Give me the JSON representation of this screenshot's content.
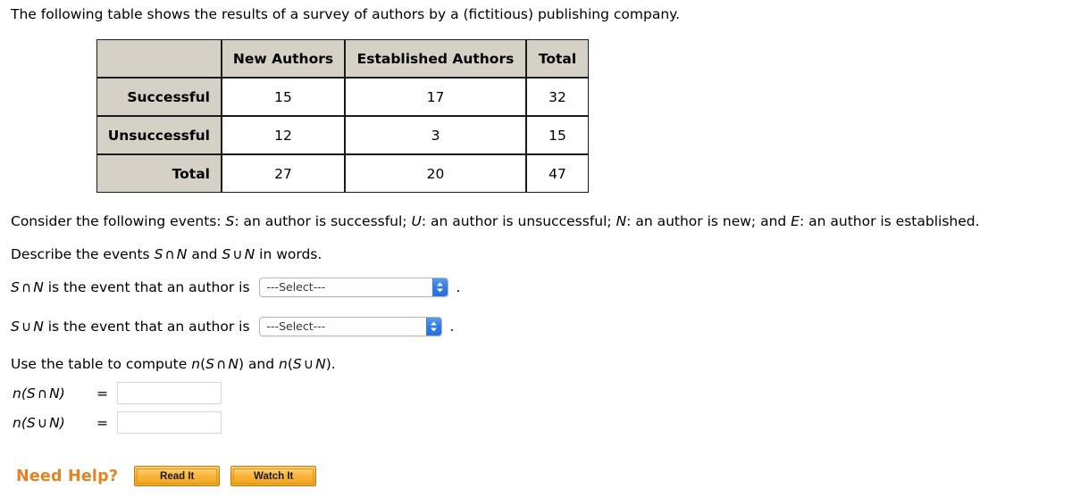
{
  "intro": {
    "text": "The following table shows the results of a survey of authors by a (fictitious) publishing company."
  },
  "table": {
    "corner_label": "",
    "column_headers": [
      "New Authors",
      "Established Authors",
      "Total"
    ],
    "rows": [
      {
        "header": "Successful",
        "cells": [
          "15",
          "17",
          "32"
        ]
      },
      {
        "header": "Unsuccessful",
        "cells": [
          "12",
          "3",
          "15"
        ]
      },
      {
        "header": "Total",
        "cells": [
          "27",
          "20",
          "47"
        ]
      }
    ],
    "header_bg": "#d5d1c7",
    "border_color": "#1a1a1a"
  },
  "events_line": {
    "prefix": "Consider the following events: ",
    "s_symbol": "S",
    "s_desc": ": an author is successful; ",
    "u_symbol": "U",
    "u_desc": ": an author is unsuccessful; ",
    "n_symbol": "N",
    "n_desc": ": an author is new; and ",
    "e_symbol": "E",
    "e_desc": ": an author is established."
  },
  "describe_line": {
    "prefix": "Describe the events ",
    "s1": "S",
    "intersect": "∩",
    "n1": "N",
    "middle": " and ",
    "s2": "S",
    "union": "∪",
    "n2": "N",
    "suffix": " in words."
  },
  "select_rows": [
    {
      "s": "S",
      "op": "∩",
      "n": "N",
      "label": " is the event that an author is",
      "value": "---Select---",
      "period": "."
    },
    {
      "s": "S",
      "op": "∪",
      "n": "N",
      "label": " is the event that an author is",
      "value": "---Select---",
      "period": "."
    }
  ],
  "compute_line": {
    "prefix": "Use the table to compute ",
    "n1": "n",
    "expr1_open": "(",
    "expr1_s": "S",
    "expr1_op": "∩",
    "expr1_n": "N",
    "expr1_close": ")",
    "middle": " and ",
    "n2": "n",
    "expr2_open": "(",
    "expr2_s": "S",
    "expr2_op": "∪",
    "expr2_n": "N",
    "expr2_close": ")",
    "suffix": "."
  },
  "answers": [
    {
      "n": "n",
      "open": "(",
      "s": "S",
      "op": "∩",
      "nn": "N",
      "close": ")",
      "equals": "=",
      "value": "",
      "placeholder": ""
    },
    {
      "n": "n",
      "open": "(",
      "s": "S",
      "op": "∪",
      "nn": "N",
      "close": ")",
      "equals": "=",
      "value": "",
      "placeholder": ""
    }
  ],
  "need_help": {
    "label": "Need Help?",
    "read_button": "Read It",
    "watch_button": "Watch It",
    "accent_color": "#e8821e"
  }
}
